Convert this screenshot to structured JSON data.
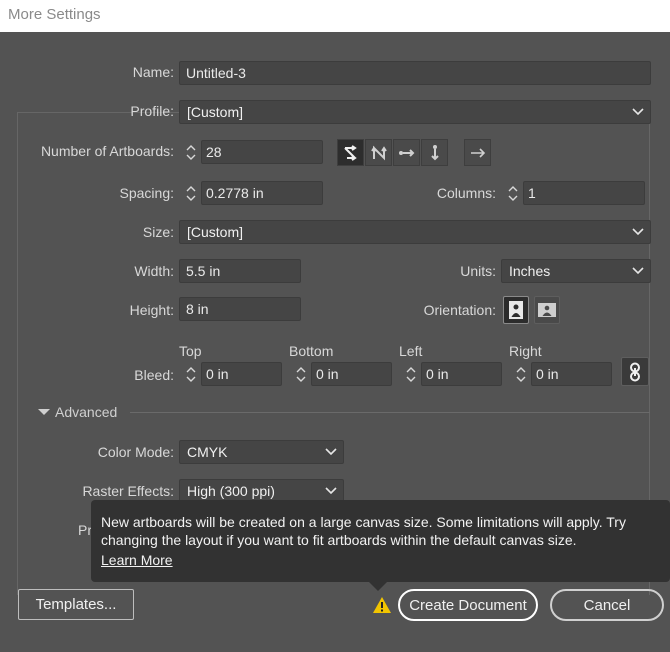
{
  "window": {
    "title": "More Settings"
  },
  "name": {
    "label": "Name:",
    "value": "Untitled-3"
  },
  "profile": {
    "label": "Profile:",
    "value": "[Custom]"
  },
  "artboards": {
    "label": "Number of Artboards:",
    "value": "28",
    "layout_icons": [
      "grid-by-row-icon",
      "grid-by-column-icon",
      "arrange-by-row-icon",
      "arrange-by-column-icon"
    ],
    "direction_icon": "arrow-right-icon"
  },
  "spacing": {
    "label": "Spacing:",
    "value": "0.2778 in"
  },
  "columns": {
    "label": "Columns:",
    "value": "1"
  },
  "size": {
    "label": "Size:",
    "value": "[Custom]"
  },
  "width": {
    "label": "Width:",
    "value": "5.5 in"
  },
  "units": {
    "label": "Units:",
    "value": "Inches"
  },
  "height": {
    "label": "Height:",
    "value": "8 in"
  },
  "orientation": {
    "label": "Orientation:",
    "options": [
      "portrait-icon",
      "landscape-icon"
    ]
  },
  "bleed": {
    "label": "Bleed:",
    "top_label": "Top",
    "top": "0 in",
    "bottom_label": "Bottom",
    "bottom": "0 in",
    "left_label": "Left",
    "left": "0 in",
    "right_label": "Right",
    "right": "0 in",
    "link_icon": "chain-link-icon"
  },
  "advanced": {
    "label": "Advanced",
    "color_mode_label": "Color Mode:",
    "color_mode": "CMYK",
    "raster_label": "Raster Effects:",
    "raster": "High (300 ppi)",
    "preview_label_partial": "Pr"
  },
  "tooltip": {
    "line1": "New artboards will be created on a large canvas size. Some limitations will apply. Try",
    "line2": "changing the layout if you want to fit artboards within the default canvas size.",
    "link": "Learn More"
  },
  "buttons": {
    "templates": "Templates...",
    "create": "Create Document",
    "cancel": "Cancel"
  },
  "colors": {
    "warning": "#f2c500",
    "background": "#535353",
    "field": "#454545"
  }
}
